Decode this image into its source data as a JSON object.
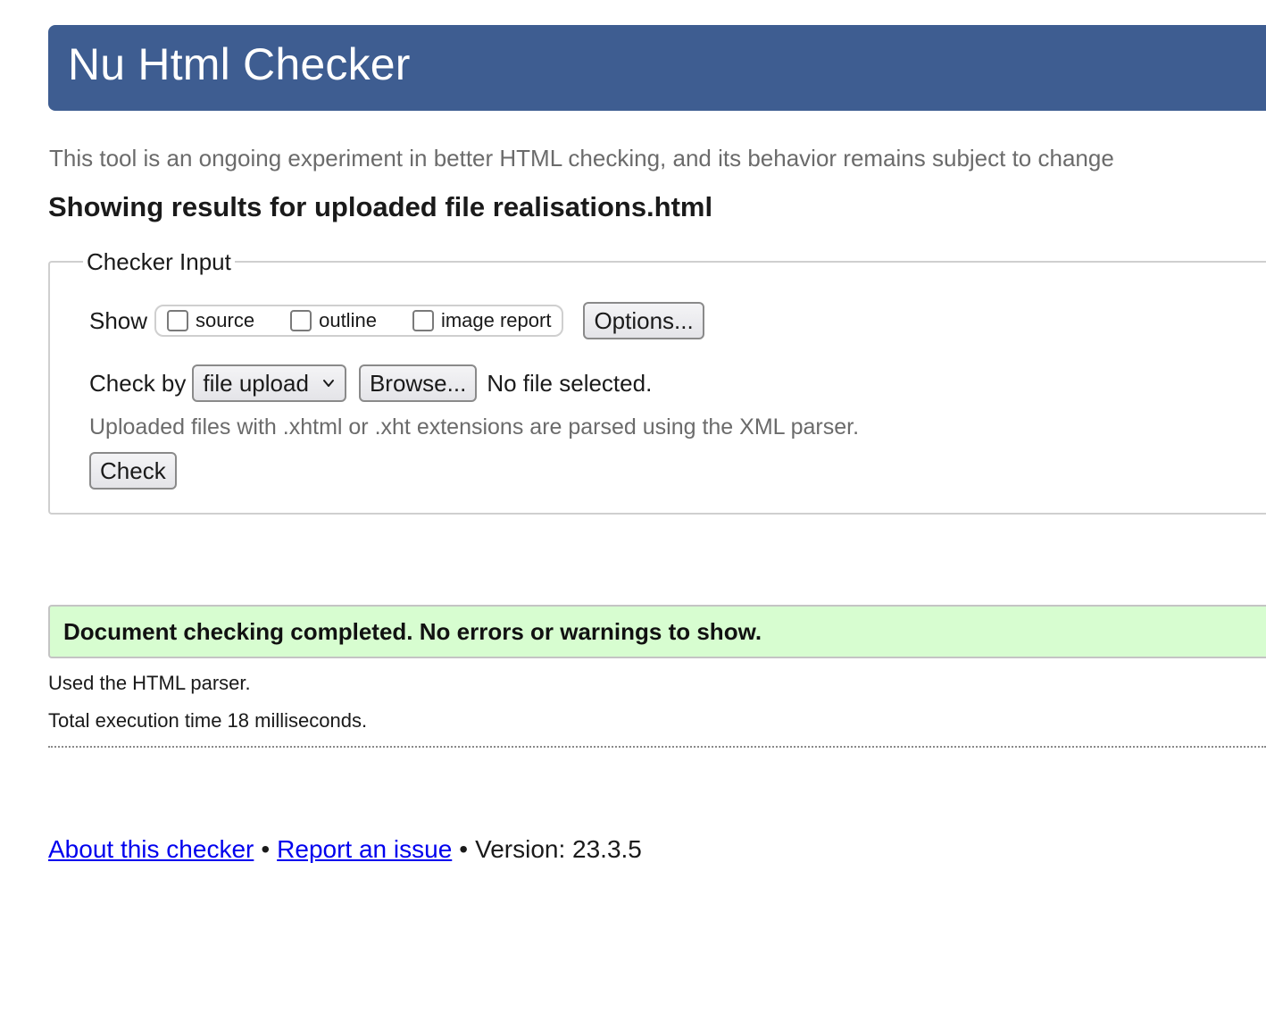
{
  "header": {
    "title": "Nu Html Checker"
  },
  "tagline": "This tool is an ongoing experiment in better HTML checking, and its behavior remains subject to change",
  "results_heading": "Showing results for uploaded file realisations.html",
  "checker_input": {
    "legend": "Checker Input",
    "show_label": "Show",
    "show_options": [
      {
        "label": "source",
        "checked": false
      },
      {
        "label": "outline",
        "checked": false
      },
      {
        "label": "image report",
        "checked": false
      }
    ],
    "options_button": "Options...",
    "check_by_label": "Check by",
    "check_by_selected": "file upload",
    "browse_button": "Browse...",
    "no_file_text": "No file selected.",
    "note": "Uploaded files with .xhtml or .xht extensions are parsed using the XML parser.",
    "check_button": "Check"
  },
  "result": {
    "message": "Document checking completed. No errors or warnings to show.",
    "parser_line": "Used the HTML parser.",
    "time_line": "Total execution time 18 milliseconds."
  },
  "footer": {
    "about_link": "About this checker",
    "separator": "•",
    "report_link": "Report an issue",
    "version": "Version: 23.3.5"
  },
  "colors": {
    "header_bg": "#3e5d91",
    "success_bg": "#d7fdd0",
    "link": "#0000ee",
    "muted_text": "#6b6b6b"
  },
  "icons": {
    "select_chevron": "chevron-down-icon",
    "checkbox": "checkbox-unchecked-icon"
  }
}
